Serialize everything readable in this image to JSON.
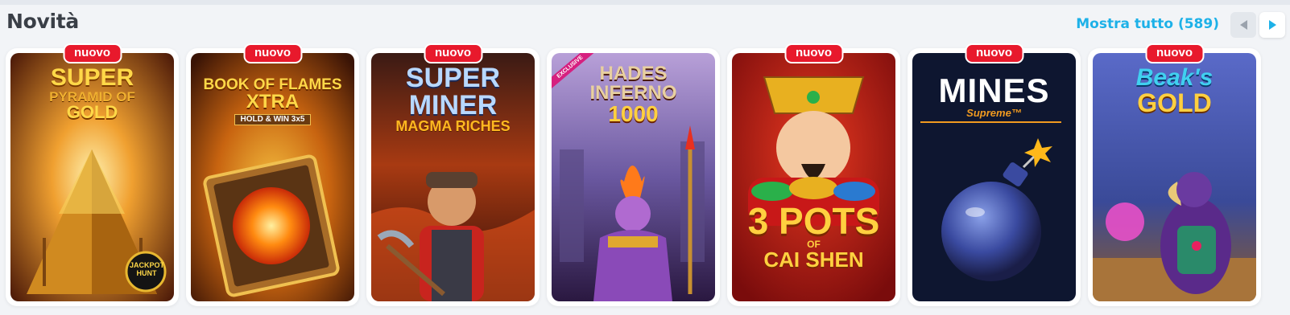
{
  "section": {
    "title": "Novità",
    "show_all_label": "Mostra tutto (589)"
  },
  "icons": {
    "prev": "chevron-left-icon",
    "next": "chevron-right-icon"
  },
  "colors": {
    "accent": "#1db1e8",
    "badge": "#e8192c",
    "exclusive": "#d6207f"
  },
  "games": [
    {
      "badge": "nuovo",
      "title_lines": [
        "SUPER",
        "PYRAMID OF",
        "GOLD"
      ],
      "extra": "JACKPOT HUNT"
    },
    {
      "badge": "nuovo",
      "title_lines": [
        "BOOK OF FLAMES",
        "XTRA",
        "HOLD & WIN 3x5"
      ]
    },
    {
      "badge": "nuovo",
      "title_lines": [
        "SUPER",
        "MINER",
        "MAGMA RICHES"
      ]
    },
    {
      "badge": "EXCLUSIVE",
      "title_lines": [
        "HADES",
        "INFERNO",
        "1000"
      ]
    },
    {
      "badge": "nuovo",
      "title_lines": [
        "3 POTS",
        "OF",
        "CAI SHEN"
      ]
    },
    {
      "badge": "nuovo",
      "title_lines": [
        "MINES",
        "Supreme™"
      ]
    },
    {
      "badge": "nuovo",
      "title_lines": [
        "Beak's",
        "GOLD"
      ]
    }
  ]
}
